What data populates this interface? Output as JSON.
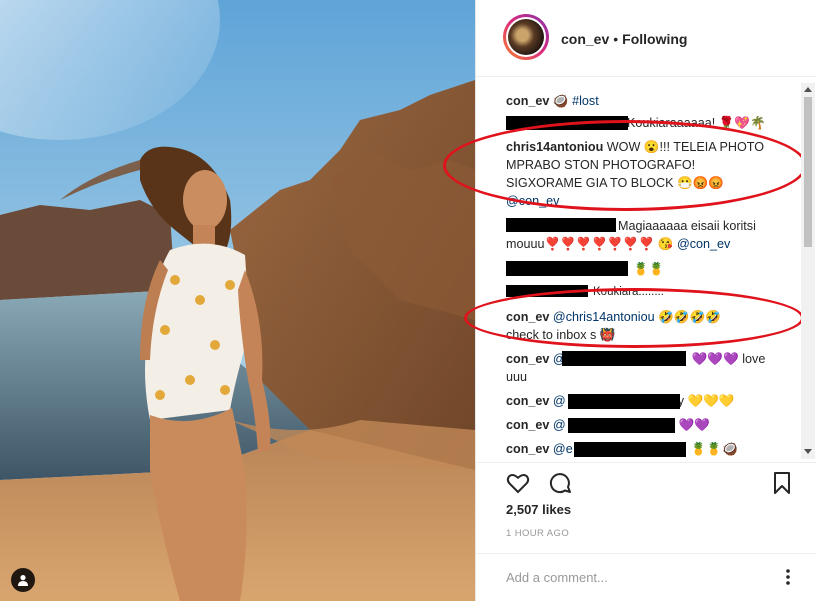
{
  "header": {
    "username": "con_ev",
    "separator": "•",
    "follow_status": "Following"
  },
  "comments": [
    {
      "user": "con_ev",
      "text": "🥥",
      "hashtag": "#lost"
    },
    {
      "user": "",
      "text": "Koukiaraaaaaa! 🌹💖🌴"
    },
    {
      "user": "chris14antoniou",
      "lines": [
        "WOW 😮!!! TELEIA PHOTO",
        "MPRABO STON PHOTOGRAFO!",
        "SIGXORAME GIA TO BLOCK 😷😡😡"
      ],
      "mention": "@con_ev"
    },
    {
      "user": "",
      "line1": "Magiaaaaaa eisaii koritsi",
      "line2": "mouuu❣️❣️❣️❣️❣️❣️❣️ 😘",
      "mention": "@con_ev"
    },
    {
      "user": "",
      "text": "🍍🍍"
    },
    {
      "user": "",
      "text": "Koukiara........"
    },
    {
      "user": "con_ev",
      "mention": "@chris14antoniou",
      "text": "🤣🤣🤣🤣",
      "line2": "check to inbox s 👹"
    },
    {
      "user": "con_ev",
      "mention": "@",
      "text": "💜💜💜 love",
      "line2": "uuu"
    },
    {
      "user": "con_ev",
      "mention": "@",
      "text": "y 💛💛💛"
    },
    {
      "user": "con_ev",
      "mention": "@",
      "text": "💜💜"
    },
    {
      "user": "con_ev",
      "mention": "@e",
      "text": "🍍🍍🥥"
    }
  ],
  "likes": "2,507 likes",
  "timestamp": "1 HOUR AGO",
  "add_comment": {
    "placeholder": "Add a comment..."
  },
  "colors": {
    "annotation": "#e0121b",
    "mention": "#003569",
    "muted": "#999999"
  },
  "icons": [
    "user-tag-icon",
    "heart-icon",
    "comment-icon",
    "bookmark-icon",
    "more-icon"
  ]
}
